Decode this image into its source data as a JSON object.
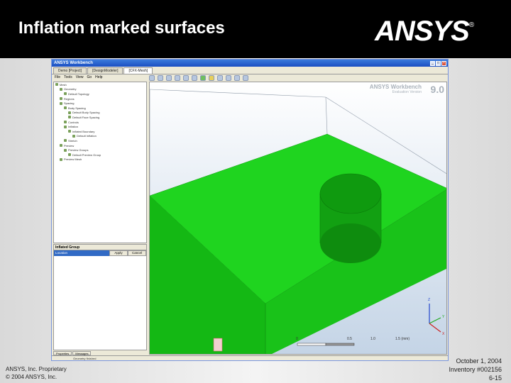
{
  "slide": {
    "title": "Inflation marked surfaces",
    "logo_text": "ANSYS",
    "logo_mark": "®",
    "footer_left": [
      "ANSYS, Inc. Proprietary",
      "© 2004 ANSYS, Inc."
    ],
    "footer_right": [
      "October 1, 2004",
      "Inventory #002156",
      "6-15"
    ]
  },
  "app": {
    "window_title": "ANSYS Workbench",
    "tabs": [
      "Demo [Project]",
      "[DesignModeler]",
      "[CFX-Mesh]"
    ],
    "menu": [
      "File",
      "Tools",
      "View",
      "Go",
      "Help"
    ],
    "details_title": "Inflated Group",
    "details_field": "Location",
    "apply_label": "Apply",
    "cancel_label": "Cancel",
    "bottom_tabs": [
      "Properties",
      "Messages"
    ],
    "status_text": "Geometry finished",
    "tree_items": [
      "Mesh",
      "Geometry",
      "Default Topology",
      "Regions",
      "Spacing",
      "Body Spacing",
      "Default Body Spacing",
      "Default Face Spacing",
      "Controls",
      "Inflation",
      "Inflated Boundary",
      "Default Inflation",
      "Stretch",
      "Preview",
      "Preview Groups",
      "Default Preview Group",
      "Preview Mesh"
    ]
  },
  "viewport": {
    "watermark_product": "ANSYS Workbench",
    "watermark_edition": "Evaluation Version",
    "watermark_version": "9.0",
    "scale_labels": [
      "0",
      "0.5",
      "1.0",
      "1.5 (mm)"
    ],
    "axis_labels": [
      "Z",
      "Y",
      "X"
    ],
    "colors": {
      "plate_top": "#1fd41f",
      "plate_side": "#14b814",
      "cylinder": "#0f8f0f"
    }
  }
}
